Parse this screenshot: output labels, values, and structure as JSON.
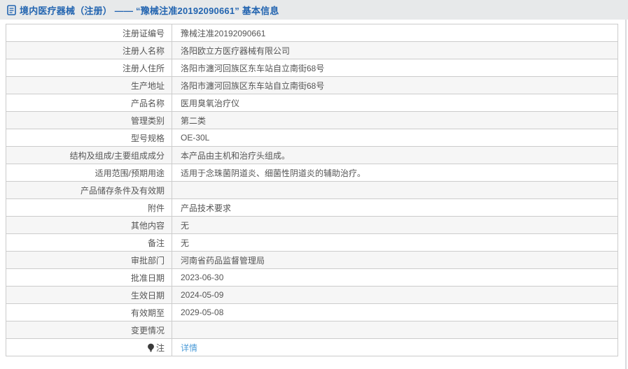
{
  "header": {
    "icon": "document-icon",
    "title": "境内医疗器械（注册） —— “豫械注准20192090661” 基本信息"
  },
  "table": {
    "rows": [
      {
        "label": "注册证编号",
        "value": "豫械注准20192090661"
      },
      {
        "label": "注册人名称",
        "value": "洛阳欧立方医疗器械有限公司"
      },
      {
        "label": "注册人住所",
        "value": "洛阳市瀍河回族区东车站自立南街68号"
      },
      {
        "label": "生产地址",
        "value": "洛阳市瀍河回族区东车站自立南街68号"
      },
      {
        "label": "产品名称",
        "value": "医用臭氧治疗仪"
      },
      {
        "label": "管理类别",
        "value": "第二类"
      },
      {
        "label": "型号规格",
        "value": "OE-30L"
      },
      {
        "label": "结构及组成/主要组成成分",
        "value": "本产品由主机和治疗头组成。"
      },
      {
        "label": "适用范围/预期用途",
        "value": "适用于念珠菌阴道炎、细菌性阴道炎的辅助治疗。"
      },
      {
        "label": "产品储存条件及有效期",
        "value": ""
      },
      {
        "label": "附件",
        "value": "产品技术要求"
      },
      {
        "label": "其他内容",
        "value": "无"
      },
      {
        "label": "备注",
        "value": "无"
      },
      {
        "label": "审批部门",
        "value": "河南省药品监督管理局"
      },
      {
        "label": "批准日期",
        "value": "2023-06-30"
      },
      {
        "label": "生效日期",
        "value": "2024-05-09"
      },
      {
        "label": "有效期至",
        "value": "2029-05-08"
      },
      {
        "label": "变更情况",
        "value": ""
      },
      {
        "label": "注",
        "value": "详情",
        "label_icon": "bulb-icon",
        "value_is_link": true
      }
    ]
  },
  "colors": {
    "header_bg": "#e7e9ea",
    "title_blue": "#2264b0",
    "link_blue": "#4d9cd8",
    "border": "#cccccc",
    "row_stripe": "#f6f6f6",
    "text": "#555555"
  }
}
